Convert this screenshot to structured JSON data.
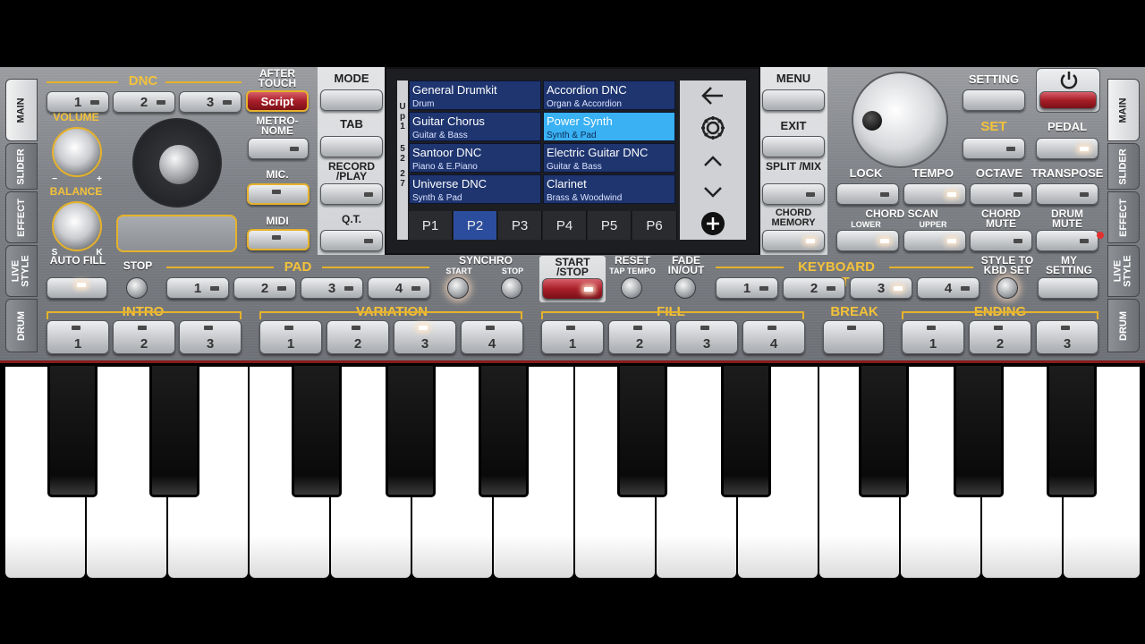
{
  "side_tabs_left": [
    "MAIN",
    "SLIDER",
    "EFFECT",
    "LIVE STYLE",
    "DRUM"
  ],
  "side_tabs_right": [
    "MAIN",
    "SLIDER",
    "EFFECT",
    "LIVE STYLE",
    "DRUM"
  ],
  "dnc": {
    "label": "DNC",
    "buttons": [
      "1",
      "2",
      "3"
    ],
    "script": "Script"
  },
  "after_touch": "AFTER TOUCH",
  "volume": "VOLUME",
  "balance": "BALANCE",
  "balance_minus": "−",
  "balance_plus": "+",
  "balance_s": "S",
  "balance_k": "K",
  "metronome": "METRO- NOME",
  "mic": "MIC.",
  "midi": "MIDI",
  "mode": "MODE",
  "tab": "TAB",
  "record_play": "RECORD /PLAY",
  "qt": "Q.T.",
  "menu": "MENU",
  "exit": "EXIT",
  "split_mix": "SPLIT /MIX",
  "chord_memory": "CHORD MEMORY",
  "setting": "SETTING",
  "set": "SET",
  "pedal": "PEDAL",
  "lock": "LOCK",
  "tempo": "TEMPO",
  "octave": "OCTAVE",
  "transpose": "TRANSPOSE",
  "chord_scan": {
    "label": "CHORD SCAN",
    "lower": "LOWER",
    "upper": "UPPER"
  },
  "chord_mute": "CHORD MUTE",
  "drum_mute": "DRUM MUTE",
  "screen": {
    "side_letters": [
      "U",
      "p",
      "1",
      "5",
      "2",
      "2",
      "7"
    ],
    "slots": [
      {
        "name": "General Drumkit",
        "category": "Drum"
      },
      {
        "name": "Accordion DNC",
        "category": "Organ & Accordion"
      },
      {
        "name": "Guitar Chorus",
        "category": "Guitar & Bass"
      },
      {
        "name": "Power Synth",
        "category": "Synth & Pad"
      },
      {
        "name": "Santoor DNC",
        "category": "Piano & E.Piano"
      },
      {
        "name": "Electric Guitar DNC",
        "category": "Guitar & Bass"
      },
      {
        "name": "Universe DNC",
        "category": "Synth & Pad"
      },
      {
        "name": "Clarinet",
        "category": "Brass & Woodwind"
      }
    ],
    "pages": [
      "P1",
      "P2",
      "P3",
      "P4",
      "P5",
      "P6"
    ],
    "active_page": "P2",
    "selected_slot": "Power Synth"
  },
  "auto_fill": "AUTO FILL",
  "stop": "STOP",
  "pad": {
    "label": "PAD",
    "buttons": [
      "1",
      "2",
      "3",
      "4"
    ]
  },
  "synchro": {
    "label": "SYNCHRO",
    "start": "START",
    "stop": "STOP"
  },
  "start_stop": "START /STOP",
  "reset": {
    "label": "RESET",
    "sub": "TAP TEMPO"
  },
  "fade": "FADE IN/OUT",
  "keyboard_set": {
    "label": "KEYBOARD SET",
    "buttons": [
      "1",
      "2",
      "3",
      "4"
    ]
  },
  "style_to_kbd": "STYLE TO KBD SET",
  "my_setting": "MY SETTING",
  "intro": {
    "label": "INTRO",
    "buttons": [
      "1",
      "2",
      "3"
    ]
  },
  "variation": {
    "label": "VARIATION",
    "buttons": [
      "1",
      "2",
      "3",
      "4"
    ]
  },
  "fill": {
    "label": "FILL",
    "buttons": [
      "1",
      "2",
      "3",
      "4"
    ]
  },
  "break": "BREAK",
  "ending": {
    "label": "ENDING",
    "buttons": [
      "1",
      "2",
      "3"
    ]
  },
  "colors": {
    "accent_gold": "#e6b22a",
    "selected_slot": "#39b1f3",
    "slot_bg": "#1e3570",
    "active_page": "#2c4d9e",
    "power_red": "#a81e28"
  }
}
